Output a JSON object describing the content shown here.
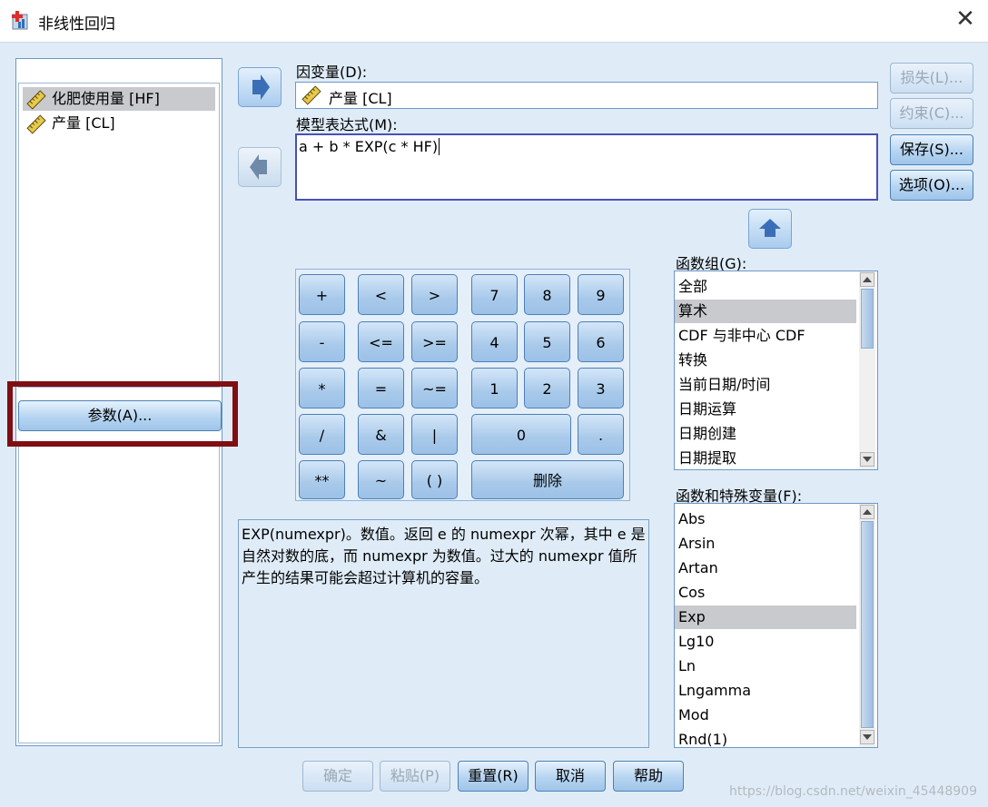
{
  "window": {
    "title": "非线性回归",
    "close_glyph": "✕"
  },
  "variables": [
    {
      "label": "化肥使用量 [HF]",
      "icon": "ruler-icon",
      "selected": true
    },
    {
      "label": "产量 [CL]",
      "icon": "ruler-icon",
      "selected": false
    }
  ],
  "parameters_button": {
    "label": "参数(A)..."
  },
  "dependent": {
    "label": "因变量(D):",
    "value": "产量 [CL]"
  },
  "model": {
    "label": "模型表达式(M):",
    "value": "a + b * EXP(c * HF)"
  },
  "side_buttons": {
    "missing": "损失(L)...",
    "constraints": "约束(C)...",
    "save": "保存(S)...",
    "options": "选项(O)..."
  },
  "keypad": {
    "plus": "+",
    "lt": "<",
    "gt": ">",
    "k7": "7",
    "k8": "8",
    "k9": "9",
    "minus": "-",
    "le": "<=",
    "ge": ">=",
    "k4": "4",
    "k5": "5",
    "k6": "6",
    "mul": "*",
    "eq": "=",
    "ne": "~=",
    "k1": "1",
    "k2": "2",
    "k3": "3",
    "div": "/",
    "and": "&",
    "or": "|",
    "k0": "0",
    "dot": ".",
    "pow": "**",
    "not": "~",
    "paren": "( )",
    "del": "删除"
  },
  "description": "EXP(numexpr)。数值。返回 e 的 numexpr 次幂，其中 e 是自然对数的底，而 numexpr 为数值。过大的 numexpr 值所产生的结果可能会超过计算机的容量。",
  "function_group": {
    "label": "函数组(G):",
    "items": [
      "全部",
      "算术",
      "CDF 与非中心 CDF",
      "转换",
      "当前日期/时间",
      "日期运算",
      "日期创建",
      "日期提取"
    ],
    "selected": "算术"
  },
  "functions": {
    "label": "函数和特殊变量(F):",
    "items": [
      "Abs",
      "Arsin",
      "Artan",
      "Cos",
      "Exp",
      "Lg10",
      "Ln",
      "Lngamma",
      "Mod",
      "Rnd(1)"
    ],
    "selected": "Exp"
  },
  "bottom_buttons": {
    "ok": "确定",
    "paste": "粘贴(P)",
    "reset": "重置(R)",
    "cancel": "取消",
    "help": "帮助"
  },
  "watermark": "https://blog.csdn.net/weixin_45448909",
  "colors": {
    "highlight_box": "#7f0f12",
    "background": "#dfecf8",
    "arrow": "#3a6fb8"
  }
}
